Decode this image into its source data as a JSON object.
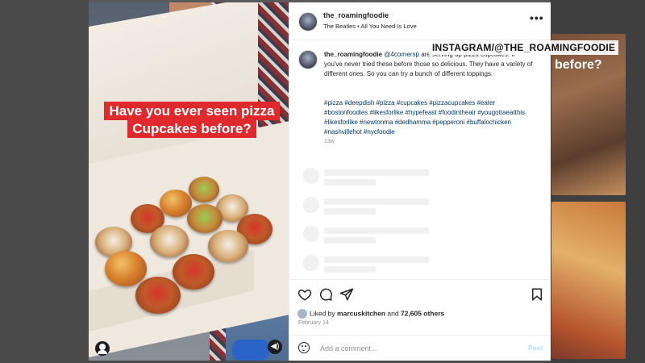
{
  "post": {
    "username": "the_roamingfoodie",
    "audio": "The Beatles • All You Need Is Love",
    "more_label": "•••",
    "overlay_caption_line1": "Have you ever seen pizza",
    "overlay_caption_line2": "Cupcakes before?",
    "caption_user": "the_roamingfoodie",
    "caption_mention": "@4cornersp",
    "caption_body": "are serving up pizza cupcakes. If you've never tried these before those so delicious. They have a variety of different ones. So you can try a bunch of different toppings.",
    "hashtags": "#pizza #deepdish #pizza #cupcakes #pizzacupcakes #eater #bostonfoodies #likesforlike #hypefeast #foodintheair #yougottaeatthis #likesforlike #newtonma #dedhamma #pepperoni #buffalochicken #nashvillehot #nycfoodie",
    "age": "13w",
    "liked_by_prefix": "Liked by ",
    "liked_by_user": "marcuskitchen",
    "liked_by_and": " and ",
    "liked_by_count": "72,605 others",
    "date": "February 14",
    "add_comment_placeholder": "Add a comment...",
    "post_label": "Post"
  },
  "background": {
    "tile_text": "before?"
  },
  "watermark": "INSTAGRAM/@THE_ROAMINGFOODIE",
  "icons": [
    "heart-icon",
    "comment-icon",
    "share-icon",
    "bookmark-icon",
    "emoji-icon",
    "user-tag-icon",
    "mute-icon",
    "more-icon"
  ],
  "colors": {
    "caption_badge": "#e0292d",
    "link": "#00376b",
    "post_disabled": "#b2dffc"
  }
}
